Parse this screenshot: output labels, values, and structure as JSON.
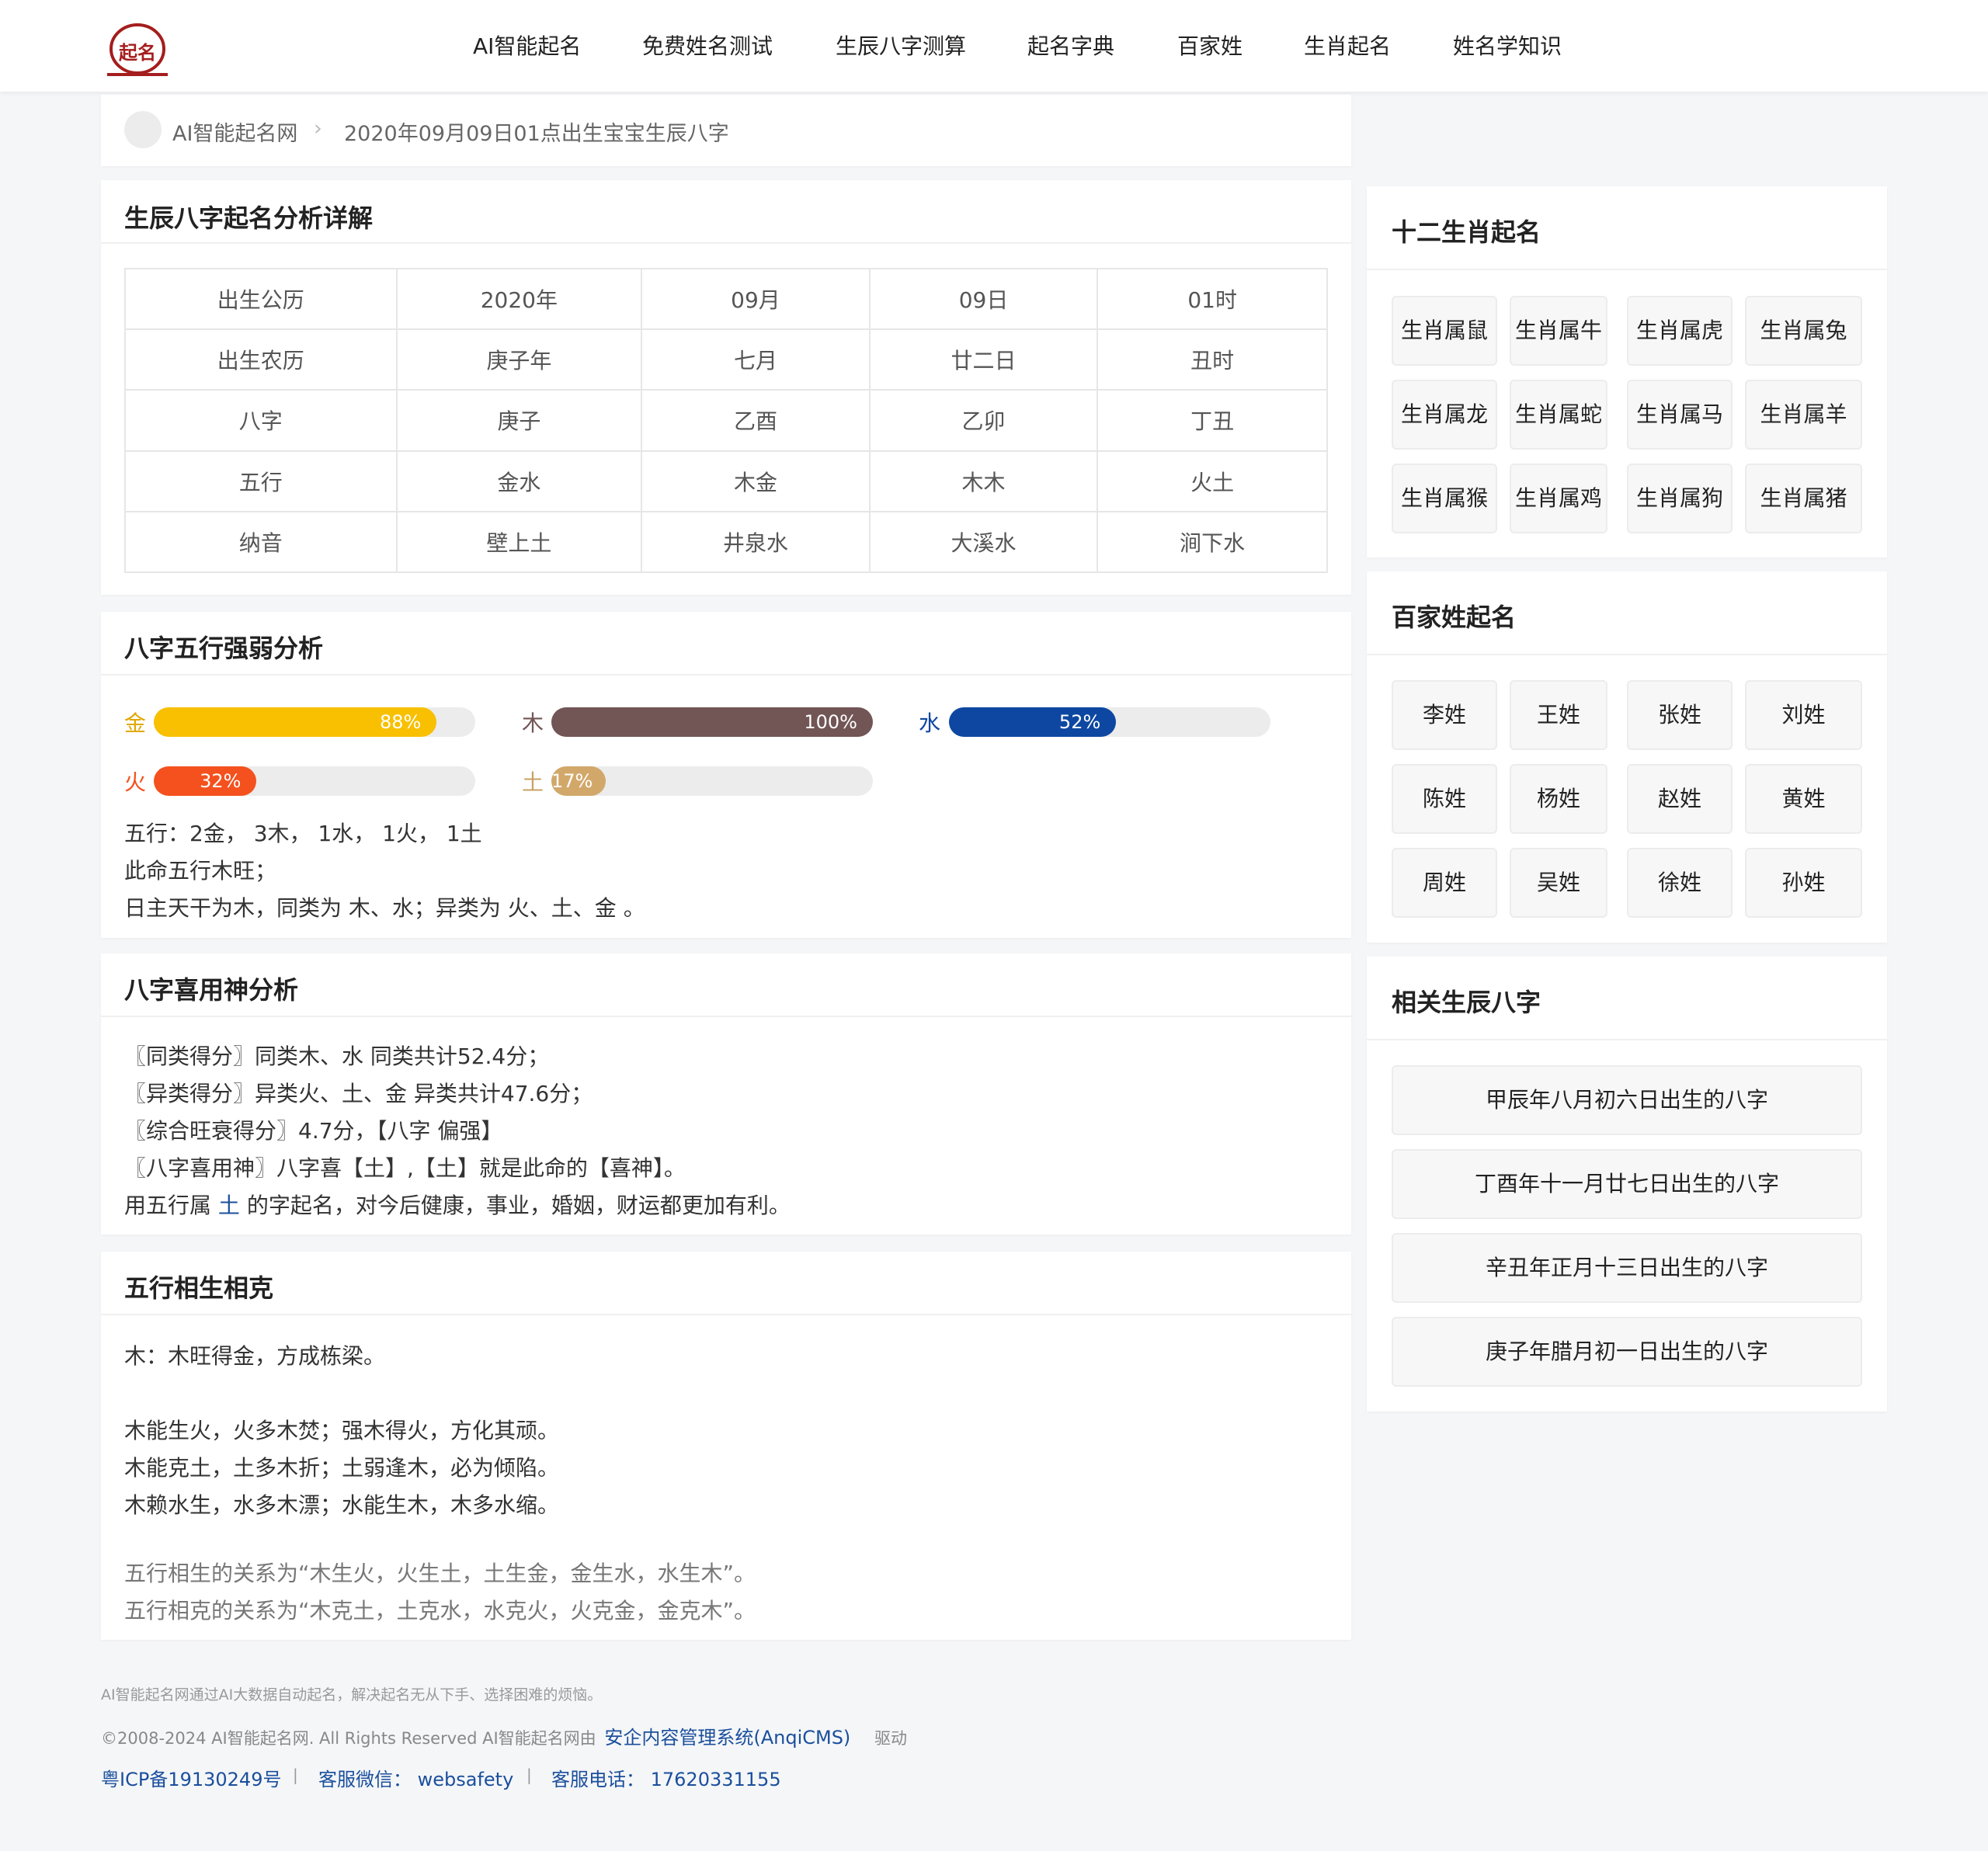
{
  "nav": {
    "logo_text": "起名",
    "items": [
      "AI智能起名",
      "免费姓名测试",
      "生辰八字测算",
      "起名字典",
      "百家姓",
      "生肖起名",
      "姓名学知识"
    ]
  },
  "breadcrumb": {
    "home": "AI智能起名网",
    "sep": "›",
    "current": "2020年09月09日01点出生宝宝生辰八字"
  },
  "bazi": {
    "title": "生辰八字起名分析详解",
    "rows": [
      [
        "出生公历",
        "2020年",
        "09月",
        "09日",
        "01时"
      ],
      [
        "出生农历",
        "庚子年",
        "七月",
        "廿二日",
        "丑时"
      ],
      [
        "八字",
        "庚子",
        "乙酉",
        "乙卯",
        "丁丑"
      ],
      [
        "五行",
        "金水",
        "木金",
        "木木",
        "火土"
      ],
      [
        "纳音",
        "壁上土",
        "井泉水",
        "大溪水",
        "涧下水"
      ]
    ]
  },
  "wuxing": {
    "title": "八字五行强弱分析",
    "bars": [
      {
        "name": "金",
        "value": 88,
        "label": "88%",
        "color": "#f8c000",
        "label_color": "#e0a800"
      },
      {
        "name": "木",
        "value": 100,
        "label": "100%",
        "color": "#725555",
        "label_color": "#725555"
      },
      {
        "name": "水",
        "value": 52,
        "label": "52%",
        "color": "#0d47a1",
        "label_color": "#0d47a1"
      },
      {
        "name": "火",
        "value": 32,
        "label": "32%",
        "color": "#f4511e",
        "label_color": "#f4511e"
      },
      {
        "name": "土",
        "value": 17,
        "label": "17%",
        "color": "#d2a86a",
        "label_color": "#c9a063"
      }
    ],
    "lines": [
      "五行：2金， 3木， 1水， 1火， 1土",
      "此命五行木旺；",
      "日主天干为木，同类为 木、水；异类为 火、土、金 。"
    ]
  },
  "xiyong": {
    "title": "八字喜用神分析",
    "lines": [
      "〖同类得分〗同类木、水     同类共计52.4分；",
      "〖异类得分〗异类火、土、金     异类共计47.6分；",
      "〖综合旺衰得分〗4.7分，【八字 偏强】",
      "〖八字喜用神〗八字喜【土】,【土】就是此命的【喜神】。"
    ],
    "last_prefix": "用五行属 ",
    "last_element": "土",
    "last_suffix": " 的字起名，对今后健康，事业，婚姻，财运都更加有利。"
  },
  "shengke": {
    "title": "五行相生相克",
    "line1": "木：木旺得金，方成栋梁。",
    "lines": [
      "木能生火，火多木焚；强木得火，方化其顽。",
      "木能克土，土多木折；土弱逢木，必为倾陷。",
      "木赖水生，水多木漂；水能生木，木多水缩。"
    ],
    "grey_lines": [
      "五行相生的关系为“木生火，火生土，土生金，金生水，水生木”。",
      "五行相克的关系为“木克土，土克水，水克火，火克金，金克木”。"
    ]
  },
  "sidebar": {
    "zodiac_title": "十二生肖起名",
    "zodiac": [
      "生肖属鼠",
      "生肖属牛",
      "生肖属虎",
      "生肖属兔",
      "生肖属龙",
      "生肖属蛇",
      "生肖属马",
      "生肖属羊",
      "生肖属猴",
      "生肖属鸡",
      "生肖属狗",
      "生肖属猪"
    ],
    "surname_title": "百家姓起名",
    "surnames": [
      "李姓",
      "王姓",
      "张姓",
      "刘姓",
      "陈姓",
      "杨姓",
      "赵姓",
      "黄姓",
      "周姓",
      "吴姓",
      "徐姓",
      "孙姓"
    ],
    "related_title": "相关生辰八字",
    "related": [
      "甲辰年八月初六日出生的八字",
      "丁酉年十一月廿七日出生的八字",
      "辛丑年正月十三日出生的八字",
      "庚子年腊月初一日出生的八字"
    ]
  },
  "footer": {
    "desc": "AI智能起名网通过AI大数据自动起名，解决起名无从下手、选择困难的烦恼。",
    "copyright": "©2008-2024 AI智能起名网. All Rights Reserved AI智能起名网由",
    "cms_link": "安企内容管理系统(AnqiCMS)",
    "powered": "驱动",
    "icp": "粤ICP备19130249号",
    "sep": "|",
    "wechat": "客服微信： websafety",
    "phone": "客服电话： 17620331155"
  }
}
